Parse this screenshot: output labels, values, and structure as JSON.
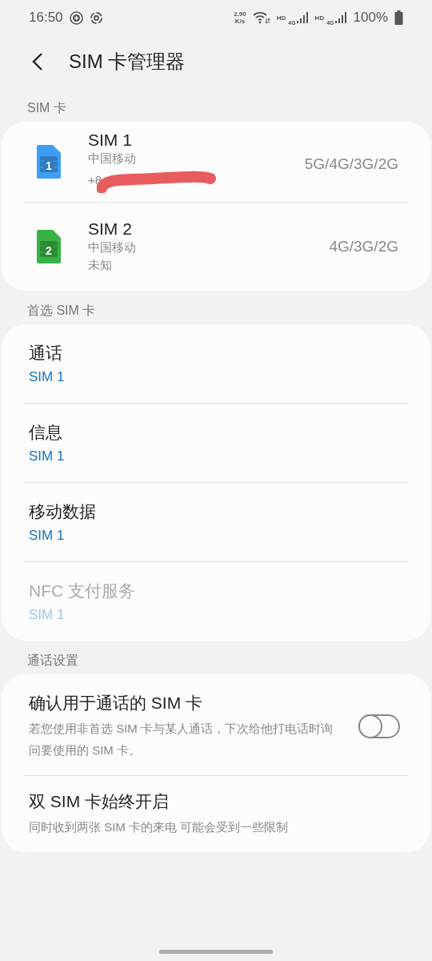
{
  "status_bar": {
    "time": "16:50",
    "speed_value": "2.90",
    "speed_unit": "K/s",
    "sim1_label": "HD",
    "sim1_network": "4G",
    "sim2_label": "HD",
    "sim2_network": "4G",
    "battery": "100%"
  },
  "header": {
    "title": "SIM 卡管理器"
  },
  "sim_section": {
    "label": "SIM 卡",
    "cards": [
      {
        "name": "SIM 1",
        "number_badge": "1",
        "color": "#3e9ef5",
        "carrier": "中国移动",
        "phone": "+8",
        "redacted": true,
        "networks": "5G/4G/3G/2G"
      },
      {
        "name": "SIM 2",
        "number_badge": "2",
        "color": "#38b245",
        "carrier": "中国移动",
        "phone": "未知",
        "redacted": false,
        "networks": "4G/3G/2G"
      }
    ]
  },
  "preferred_section": {
    "label": "首选 SIM 卡",
    "items": [
      {
        "title": "通话",
        "value": "SIM 1",
        "disabled": false
      },
      {
        "title": "信息",
        "value": "SIM 1",
        "disabled": false
      },
      {
        "title": "移动数据",
        "value": "SIM 1",
        "disabled": false
      },
      {
        "title": "NFC 支付服务",
        "value": "SIM 1",
        "disabled": true
      }
    ]
  },
  "call_settings_section": {
    "label": "通话设置",
    "items": [
      {
        "kind": "toggle",
        "title": "确认用于通话的 SIM 卡",
        "description": "若您使用非首选 SIM 卡与某人通话，下次给他打电话时询问要使用的 SIM 卡。",
        "on": false
      },
      {
        "kind": "plain",
        "title": "双 SIM 卡始终开启",
        "description": "同时收到两张 SIM 卡的来电 可能会受到一些限制"
      }
    ]
  }
}
